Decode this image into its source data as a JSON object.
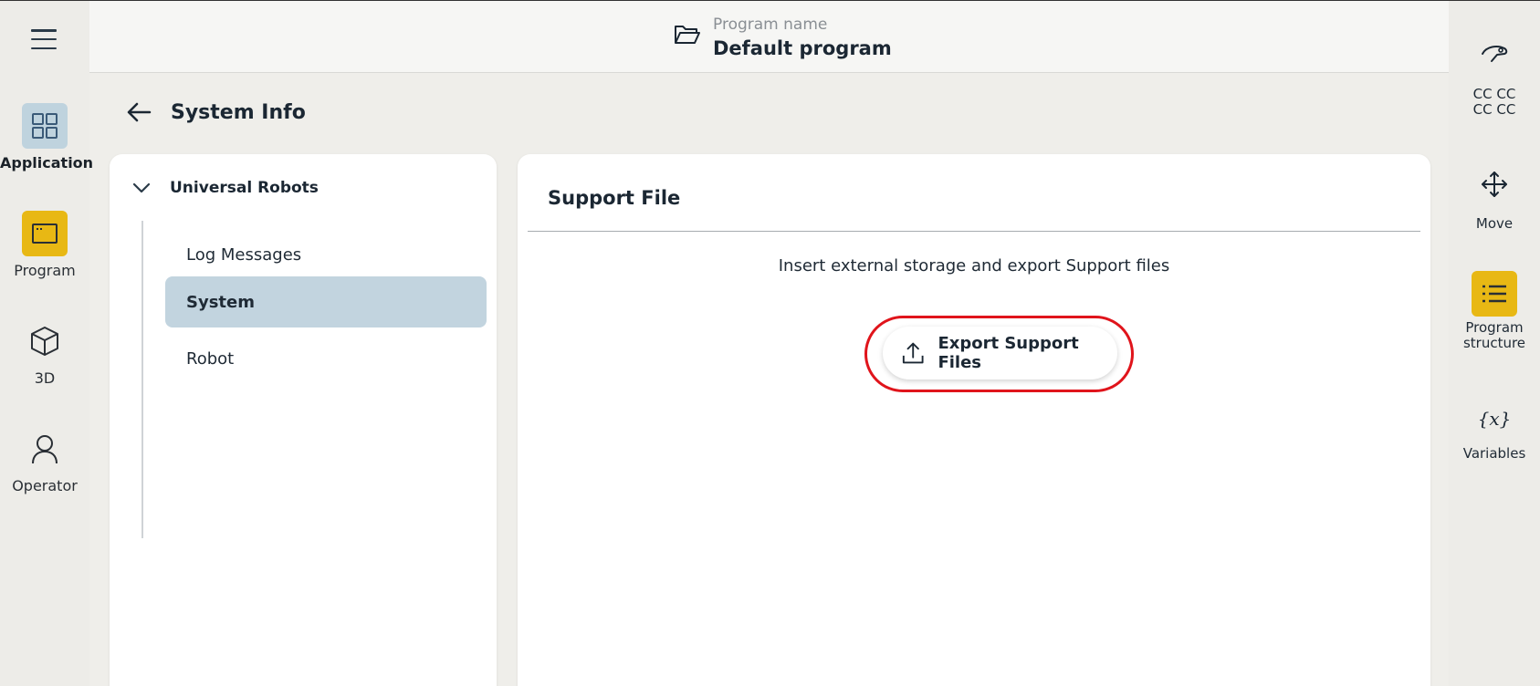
{
  "left_rail": {
    "items": [
      {
        "label": "Application",
        "icon": "grid-icon"
      },
      {
        "label": "Program",
        "icon": "program-window-icon"
      },
      {
        "label": "3D",
        "icon": "cube-icon"
      },
      {
        "label": "Operator",
        "icon": "person-icon"
      }
    ]
  },
  "header": {
    "caption": "Program name",
    "program_name": "Default program"
  },
  "page": {
    "title": "System Info"
  },
  "tree": {
    "root_label": "Universal Robots",
    "items": [
      {
        "label": "Log Messages",
        "selected": false
      },
      {
        "label": "System",
        "selected": true
      },
      {
        "label": "Robot",
        "selected": false
      }
    ]
  },
  "content": {
    "section_title": "Support File",
    "instructions": "Insert external storage and export Support files",
    "export_button_label": "Export Support Files"
  },
  "right_rail": {
    "robot_label_line1": "CC CC",
    "robot_label_line2": "CC CC",
    "move_label": "Move",
    "program_structure_line1": "Program",
    "program_structure_line2": "structure",
    "variables_label": "Variables",
    "variables_glyph": "{x}"
  },
  "colors": {
    "accent_yellow": "#e8b814",
    "selection_blue": "#c2d4df",
    "highlight_red": "#e0141b"
  }
}
